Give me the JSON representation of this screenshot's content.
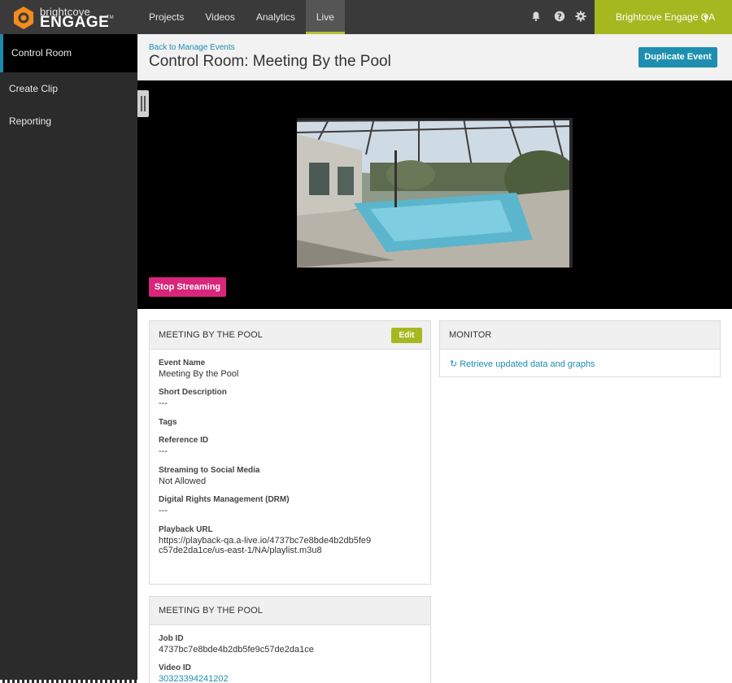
{
  "logo": {
    "brand": "brightcove",
    "product": "ENGAGE",
    "tm": "TM"
  },
  "nav": {
    "items": [
      "Projects",
      "Videos",
      "Analytics",
      "Live"
    ],
    "active": "Live"
  },
  "header_icons": [
    "bell-icon",
    "help-icon",
    "gear-icon"
  ],
  "account": {
    "label": "Brightcove Engage QA",
    "caret": "▼"
  },
  "sidebar": {
    "items": [
      "Control Room",
      "Create Clip",
      "Reporting"
    ],
    "active": "Control Room"
  },
  "page": {
    "back_link": "Back to Manage Events",
    "title": "Control Room: Meeting By the Pool",
    "duplicate_label": "Duplicate Event"
  },
  "player": {
    "stop_label": "Stop Streaming"
  },
  "details": {
    "title": "MEETING BY THE POOL",
    "edit_label": "Edit",
    "fields": [
      {
        "label": "Event Name",
        "value": "Meeting By the Pool"
      },
      {
        "label": "Short Description",
        "value": "---"
      },
      {
        "label": "Tags",
        "value": ""
      },
      {
        "label": "Reference ID",
        "value": "---"
      },
      {
        "label": "Streaming to Social Media",
        "value": "Not Allowed"
      },
      {
        "label": "Digital Rights Management (DRM)",
        "value": "---"
      },
      {
        "label": "Playback URL",
        "value": "https://playback-qa.a-live.io/4737bc7e8bde4b2db5fe9c57de2da1ce/us-east-1/NA/playlist.m3u8"
      }
    ]
  },
  "monitor": {
    "title": "MONITOR",
    "refresh_label": "Retrieve updated data and graphs"
  },
  "jobs": {
    "title": "MEETING BY THE POOL",
    "fields": [
      {
        "label": "Job ID",
        "value": "4737bc7e8bde4b2db5fe9c57de2da1ce"
      },
      {
        "label": "Video ID",
        "value": "30323394241202"
      }
    ]
  },
  "colors": {
    "topbar": "#3a3a3a",
    "accent_green": "#a6b81f",
    "accent_blue": "#1e8fb0",
    "stop_pink": "#d8267a",
    "sidebar": "#2b2b2b"
  }
}
